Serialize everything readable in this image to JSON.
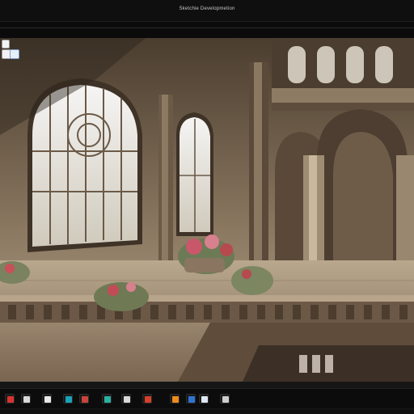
{
  "window": {
    "title": "Sketchie Developmetion"
  },
  "canvas": {
    "alt": "ornate gothic conservatory interior with arched windows and flower planters",
    "palette": {
      "shadow": "#3b2f24",
      "stone": "#a08c70",
      "light": "#e9e2d2",
      "window": "#f2f0ea",
      "flowers_red": "#b64a4e",
      "flowers_pink": "#d47a86",
      "foliage": "#6f7a55"
    }
  },
  "left_toolbar": {
    "items": [
      {
        "icon": "layer-icon"
      },
      {
        "icon": "brush-icon"
      },
      {
        "icon": "selection-icon"
      }
    ]
  },
  "taskbar": {
    "items": [
      {
        "icon": "red-app-icon",
        "color": "#d8332e"
      },
      {
        "icon": "cloud-icon",
        "color": "#d9d9d9"
      },
      {
        "icon": "mail-icon",
        "color": "#e9e9e9"
      },
      {
        "icon": "cyan-app-icon",
        "color": "#1aa3b8"
      },
      {
        "icon": "red-document-icon",
        "color": "#c9443b"
      },
      {
        "icon": "image-viewer-icon",
        "color": "#2cb0a0"
      },
      {
        "icon": "blank-window-icon",
        "color": "#dadada"
      },
      {
        "icon": "orange-red-app-icon",
        "color": "#d6402a"
      },
      {
        "icon": "orange-app-icon",
        "color": "#f08a1c"
      },
      {
        "icon": "blue-app-icon",
        "color": "#2f74d0"
      },
      {
        "icon": "disk-icon",
        "color": "#dfe7f3"
      },
      {
        "icon": "pencil-icon",
        "color": "#cfcfcf"
      }
    ]
  }
}
